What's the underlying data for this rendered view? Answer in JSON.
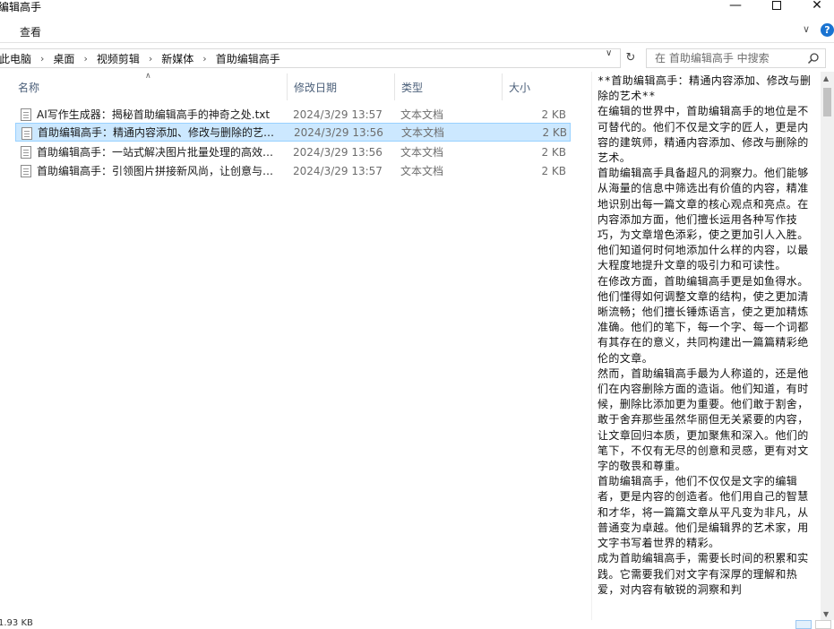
{
  "window": {
    "title": "编辑高手"
  },
  "ribbon": {
    "tab_view": "查看"
  },
  "address": {
    "crumbs": [
      "此电脑",
      "桌面",
      "视频剪辑",
      "新媒体",
      "首助编辑高手"
    ],
    "search_placeholder": "在 首助编辑高手 中搜索"
  },
  "columns": {
    "name": "名称",
    "date": "修改日期",
    "type": "类型",
    "size": "大小"
  },
  "files": [
    {
      "name": "AI写作生成器：揭秘首助编辑高手的神奇之处.txt",
      "date": "2024/3/29 13:57",
      "type": "文本文档",
      "size": "2 KB",
      "selected": false
    },
    {
      "name": "首助编辑高手：精通内容添加、修改与删除的艺术.txt",
      "date": "2024/3/29 13:56",
      "type": "文本文档",
      "size": "2 KB",
      "selected": true
    },
    {
      "name": "首助编辑高手：一站式解决图片批量处理的高效利器.txt",
      "date": "2024/3/29 13:56",
      "type": "文本文档",
      "size": "2 KB",
      "selected": false
    },
    {
      "name": "首助编辑高手：引领图片拼接新风尚，让创意与美感并存.txt",
      "date": "2024/3/29 13:57",
      "type": "文本文档",
      "size": "2 KB",
      "selected": false
    }
  ],
  "preview": {
    "text": "**首助编辑高手：精通内容添加、修改与删除的艺术**\n在编辑的世界中，首助编辑高手的地位是不可替代的。他们不仅是文字的匠人，更是内容的建筑师，精通内容添加、修改与删除的艺术。\n首助编辑高手具备超凡的洞察力。他们能够从海量的信息中筛选出有价值的内容，精准地识别出每一篇文章的核心观点和亮点。在内容添加方面，他们擅长运用各种写作技巧，为文章增色添彩，使之更加引人入胜。他们知道何时何地添加什么样的内容，以最大程度地提升文章的吸引力和可读性。\n在修改方面，首助编辑高手更是如鱼得水。他们懂得如何调整文章的结构，使之更加清晰流畅；他们擅长锤炼语言，使之更加精炼准确。他们的笔下，每一个字、每一个词都有其存在的意义，共同构建出一篇篇精彩绝伦的文章。\n然而，首助编辑高手最为人称道的，还是他们在内容删除方面的造诣。他们知道，有时候，删除比添加更为重要。他们敢于割舍，敢于舍弃那些虽然华丽但无关紧要的内容，让文章回归本质，更加聚焦和深入。他们的笔下，不仅有无尽的创意和灵感，更有对文字的敬畏和尊重。\n首助编辑高手，他们不仅仅是文字的编辑者，更是内容的创造者。他们用自己的智慧和才华，将一篇篇文章从平凡变为非凡，从普通变为卓越。他们是编辑界的艺术家，用文字书写着世界的精彩。\n成为首助编辑高手，需要长时间的积累和实践。它需要我们对文字有深厚的理解和热爱，对内容有敏锐的洞察和判"
  },
  "status": {
    "text": "1.93 KB"
  }
}
